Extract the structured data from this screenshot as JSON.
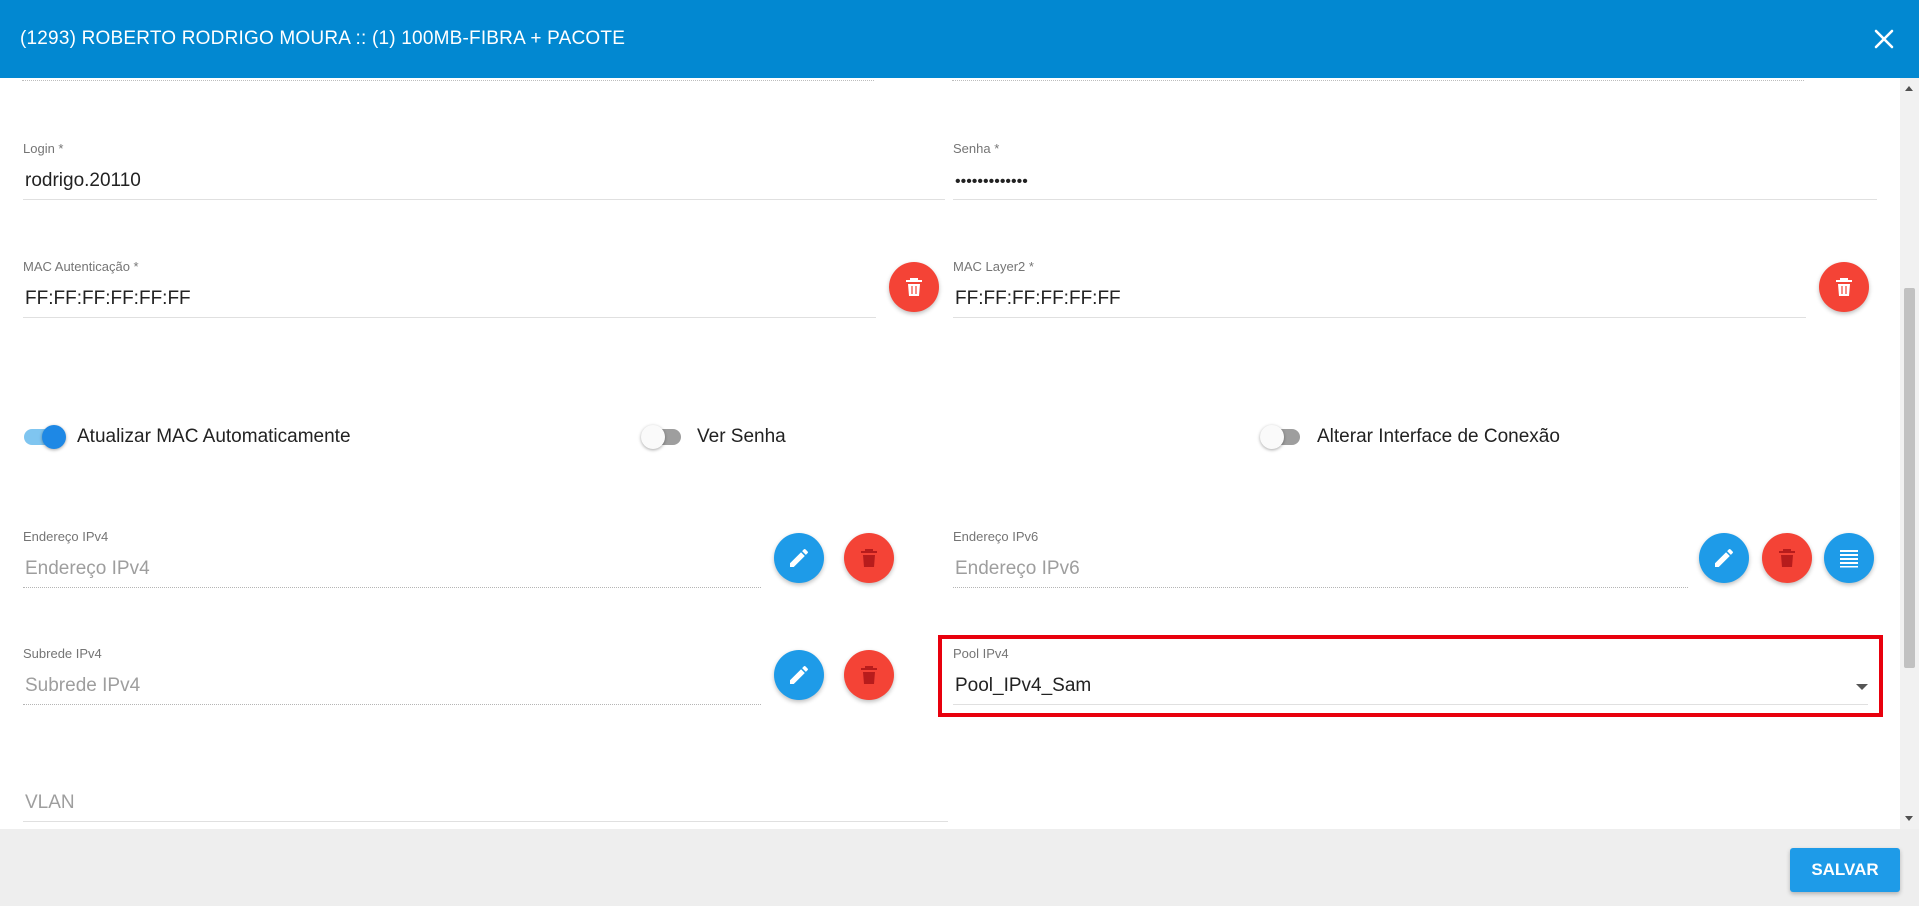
{
  "dialog": {
    "title": "(1293) ROBERTO RODRIGO MOURA :: (1) 100MB-FIBRA + PACOTE",
    "close_icon": "close-icon"
  },
  "form": {
    "login": {
      "label": "Login *",
      "value": "rodrigo.20110"
    },
    "senha": {
      "label": "Senha *",
      "value": "•••••••••••••"
    },
    "mac_autenticacao": {
      "label": "MAC Autenticação *",
      "value": "FF:FF:FF:FF:FF:FF"
    },
    "mac_layer2": {
      "label": "MAC Layer2 *",
      "value": "FF:FF:FF:FF:FF:FF"
    },
    "toggles": {
      "atualizar_mac": {
        "label": "Atualizar MAC Automaticamente",
        "on": true
      },
      "ver_senha": {
        "label": "Ver Senha",
        "on": false
      },
      "alterar_interface": {
        "label": "Alterar Interface de Conexão",
        "on": false
      }
    },
    "ipv4": {
      "label": "Endereço IPv4",
      "placeholder": "Endereço IPv4"
    },
    "ipv6": {
      "label": "Endereço IPv6",
      "placeholder": "Endereço IPv6"
    },
    "subrede": {
      "label": "Subrede IPv4",
      "placeholder": "Subrede IPv4"
    },
    "pool": {
      "label": "Pool IPv4",
      "value": "Pool_IPv4_Sam"
    },
    "vlan": {
      "placeholder": "VLAN"
    }
  },
  "footer": {
    "save_label": "SALVAR"
  },
  "colors": {
    "header": "#0288d1",
    "accent_blue": "#1e9be8",
    "danger_red": "#f44336",
    "highlight_red": "#e8000d"
  }
}
